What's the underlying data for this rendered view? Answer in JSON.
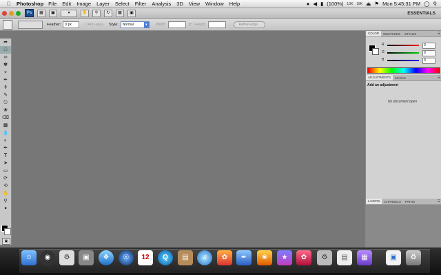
{
  "menubar": {
    "app_name": "Photoshop",
    "items": [
      "File",
      "Edit",
      "Image",
      "Layer",
      "Select",
      "Filter",
      "Analysis",
      "3D",
      "View",
      "Window",
      "Help"
    ],
    "battery": "(100%)",
    "net_in": "13K",
    "net_out": "18K",
    "clock": "Mon 5:45:31 PM"
  },
  "appbar": {
    "logo": "Ps",
    "workspace": "ESSENTIALS"
  },
  "options": {
    "feather_label": "Feather:",
    "feather_value": "0 px",
    "antialias_label": "Anti-alias",
    "style_label": "Style:",
    "style_value": "Normal",
    "width_label": "Width:",
    "height_label": "Height:",
    "refine_label": "Refine Edge..."
  },
  "color_panel": {
    "tabs": [
      "COLOR",
      "SWATCHES",
      "STYLES"
    ],
    "r_label": "R",
    "r_value": "0",
    "g_label": "G",
    "g_value": "0",
    "b_label": "B",
    "b_value": "0"
  },
  "adjust_panel": {
    "tabs": [
      "ADJUSTMENTS",
      "MASKS"
    ],
    "title": "Add an adjustment",
    "empty": "No document open"
  },
  "layers_panel": {
    "tabs": [
      "LAYERS",
      "CHANNELS",
      "PATHS"
    ]
  },
  "colors": {
    "canvas": "#777777",
    "accent": "#4d7fd6"
  }
}
